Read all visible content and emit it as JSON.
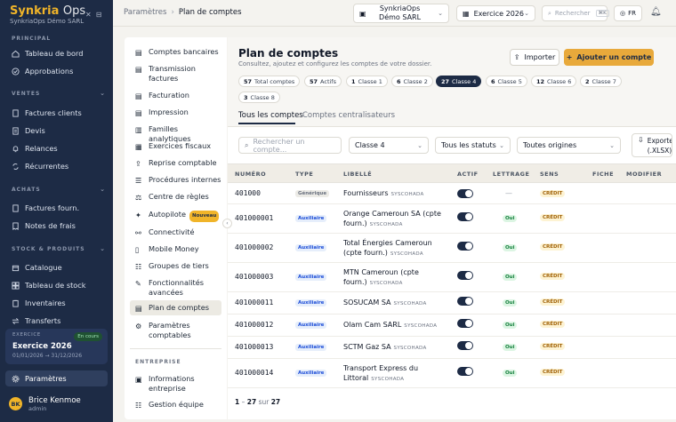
{
  "sidebar": {
    "brand_a": "Synkria",
    "brand_b": "Ops",
    "org": "SynkriaOps Démo SARL",
    "sections": [
      {
        "title": "PRINCIPAL",
        "y": 0
      },
      {
        "title": "VENTES"
      },
      {
        "title": "ACHATS"
      },
      {
        "title": "STOCK & PRODUITS"
      }
    ],
    "items": [
      {
        "label": "Tableau de bord",
        "icon": "home-icon"
      },
      {
        "label": "Approbations",
        "icon": "check-circle-icon"
      },
      {
        "label": "Factures clients",
        "icon": "invoice-icon"
      },
      {
        "label": "Devis",
        "icon": "document-icon"
      },
      {
        "label": "Relances",
        "icon": "bell-icon"
      },
      {
        "label": "Récurrentes",
        "icon": "repeat-icon"
      },
      {
        "label": "Factures fourn.",
        "icon": "invoice-icon"
      },
      {
        "label": "Notes de frais",
        "icon": "receipt-icon"
      },
      {
        "label": "Catalogue",
        "icon": "box-icon"
      },
      {
        "label": "Tableau de stock",
        "icon": "grid-icon"
      },
      {
        "label": "Inventaires",
        "icon": "clipboard-icon"
      },
      {
        "label": "Transferts",
        "icon": "arrows-icon"
      }
    ],
    "exercise": {
      "label": "EXERCICE",
      "name": "Exercice 2026",
      "dates": "01/01/2026 → 31/12/2026",
      "status": "En cours"
    },
    "settings_label": "Paramètres",
    "user": {
      "initials": "BK",
      "name": "Brice Kenmoe",
      "role": "admin"
    }
  },
  "topbar": {
    "crumb_root": "Paramètres",
    "crumb_current": "Plan de comptes",
    "company": "SynkriaOps Démo SARL",
    "exercise": "Exercice 2026",
    "search_placeholder": "Rechercher",
    "search_kbd": "⌘K",
    "lang": "FR"
  },
  "subnav": {
    "items": [
      "Comptes bancaires",
      "Transmission factures",
      "Facturation",
      "Impression",
      "Familles analytiques",
      "Exercices fiscaux",
      "Reprise comptable",
      "Procédures internes",
      "Centre de règles",
      "Autopilote",
      "Connectivité",
      "Mobile Money",
      "Groupes de tiers",
      "Fonctionnalités avancées",
      "Plan de comptes",
      "Paramètres comptables"
    ],
    "new_badge": "Nouveau",
    "section2": "ENTREPRISE",
    "items2": [
      "Informations entreprise",
      "Gestion équipe"
    ]
  },
  "page": {
    "title": "Plan de comptes",
    "subtitle": "Consultez, ajoutez et configurez les comptes de votre dossier.",
    "import_label": "Importer",
    "add_label": "Ajouter un compte",
    "chips": [
      {
        "count": "57",
        "label": "Total comptes"
      },
      {
        "count": "57",
        "label": "Actifs"
      },
      {
        "count": "1",
        "label": "Classe 1"
      },
      {
        "count": "6",
        "label": "Classe 2"
      },
      {
        "count": "27",
        "label": "Classe 4"
      },
      {
        "count": "6",
        "label": "Classe 5"
      },
      {
        "count": "12",
        "label": "Classe 6"
      },
      {
        "count": "2",
        "label": "Classe 7"
      },
      {
        "count": "3",
        "label": "Classe 8"
      }
    ],
    "tabs": [
      "Tous les comptes",
      "Comptes centralisateurs"
    ],
    "filters": {
      "search_placeholder": "Rechercher un compte...",
      "classe": "Classe 4",
      "statuts": "Tous les statuts",
      "origines": "Toutes origines",
      "export": "Exporter (.XLSX)"
    },
    "columns": [
      "NUMÉRO",
      "TYPE",
      "LIBELLÉ",
      "ACTIF",
      "LETTRAGE",
      "SENS",
      "FICHE",
      "MODIFIER"
    ],
    "rows": [
      {
        "num": "401000",
        "type": "Générique",
        "lib": "Fournisseurs",
        "sys": "SYSCOHADA",
        "lettrage": "—",
        "sens": "CRÉDIT"
      },
      {
        "num": "401000001",
        "type": "Auxiliaire",
        "lib": "Orange Cameroun SA (cpte fourn.)",
        "sys": "SYSCOHADA",
        "lettrage": "Oui",
        "sens": "CRÉDIT"
      },
      {
        "num": "401000002",
        "type": "Auxiliaire",
        "lib": "Total Énergies Cameroun (cpte fourn.)",
        "sys": "SYSCOHADA",
        "lettrage": "Oui",
        "sens": "CRÉDIT"
      },
      {
        "num": "401000003",
        "type": "Auxiliaire",
        "lib": "MTN Cameroun (cpte fourn.)",
        "sys": "SYSCOHADA",
        "lettrage": "Oui",
        "sens": "CRÉDIT"
      },
      {
        "num": "401000011",
        "type": "Auxiliaire",
        "lib": "SOSUCAM SA",
        "sys": "SYSCOHADA",
        "lettrage": "Oui",
        "sens": "CRÉDIT"
      },
      {
        "num": "401000012",
        "type": "Auxiliaire",
        "lib": "Olam Cam SARL",
        "sys": "SYSCOHADA",
        "lettrage": "Oui",
        "sens": "CRÉDIT"
      },
      {
        "num": "401000013",
        "type": "Auxiliaire",
        "lib": "SCTM Gaz SA",
        "sys": "SYSCOHADA",
        "lettrage": "Oui",
        "sens": "CRÉDIT"
      },
      {
        "num": "401000014",
        "type": "Auxiliaire",
        "lib": "Transport Express du Littoral",
        "sys": "SYSCOHADA",
        "lettrage": "Oui",
        "sens": "CRÉDIT"
      }
    ],
    "pager": {
      "from": "1",
      "to": "27",
      "sep": "sur",
      "total": "27"
    }
  }
}
